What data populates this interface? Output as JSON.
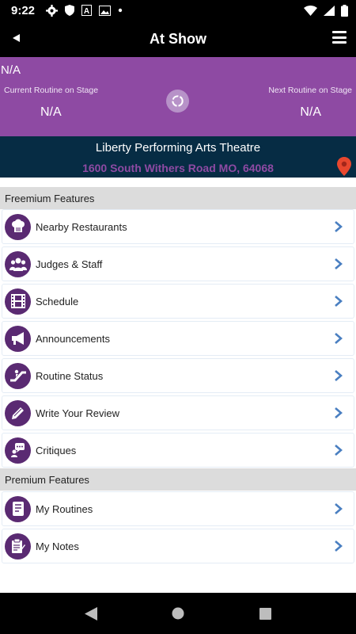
{
  "status_bar": {
    "time": "9:22",
    "left_icons": [
      "gear-icon",
      "shield-icon",
      "a-icon",
      "gallery-icon",
      "dot-icon"
    ],
    "right_icons": [
      "wifi-icon",
      "signal-icon",
      "battery-icon"
    ]
  },
  "app_bar": {
    "title": "At Show",
    "back_icon": "back-arrow-icon",
    "menu_icon": "hamburger-menu-icon"
  },
  "stage": {
    "top_text": "N/A",
    "current_label": "Current Routine on Stage",
    "current_value": "N/A",
    "next_label": "Next Routine on Stage",
    "next_value": "N/A",
    "refresh_icon": "refresh-icon"
  },
  "venue": {
    "name": "Liberty Performing Arts Theatre",
    "address": "1600 South Withers Road MO, 64068",
    "pin_icon": "map-pin-icon"
  },
  "freemium": {
    "header": "Freemium Features",
    "items": [
      {
        "label": "Nearby Restaurants",
        "icon": "chef-hat-icon"
      },
      {
        "label": "Judges & Staff",
        "icon": "people-icon"
      },
      {
        "label": "Schedule",
        "icon": "film-strip-icon"
      },
      {
        "label": "Announcements",
        "icon": "megaphone-icon"
      },
      {
        "label": "Routine Status",
        "icon": "escalator-icon"
      },
      {
        "label": "Write Your Review",
        "icon": "pencil-icon"
      },
      {
        "label": "Critiques",
        "icon": "speech-bubble-icon"
      }
    ]
  },
  "premium": {
    "header": "Premium Features",
    "items": [
      {
        "label": "My Routines",
        "icon": "document-icon"
      },
      {
        "label": "My Notes",
        "icon": "clipboard-icon"
      }
    ]
  },
  "nav_bar": {
    "buttons": [
      "back-triangle-icon",
      "home-circle-icon",
      "recents-square-icon"
    ]
  },
  "colors": {
    "accent_purple": "#8e4aa3",
    "icon_purple": "#5a2a72",
    "venue_bg": "#062c44",
    "chevron_blue": "#4a7fc1",
    "pin_red": "#e8472e"
  }
}
